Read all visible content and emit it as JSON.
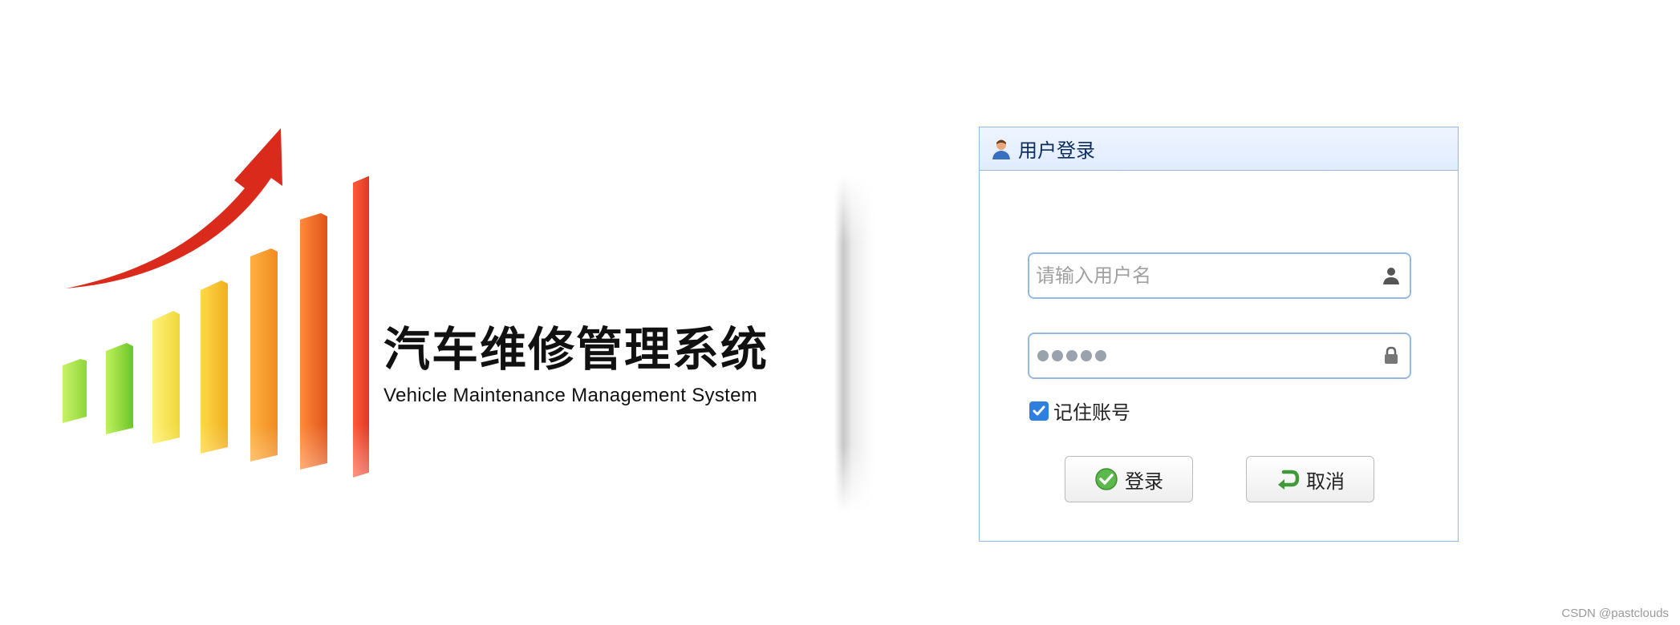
{
  "brand": {
    "title_cn": "汽车维修管理系统",
    "title_en": "Vehicle Maintenance Management System",
    "logo_icon": "growth-bar-chart-icon"
  },
  "login": {
    "header_title": "用户登录",
    "header_icon": "user-icon",
    "username": {
      "placeholder": "请输入用户名",
      "value": "",
      "icon": "user-icon"
    },
    "password": {
      "masked_value": "•••••",
      "icon": "lock-icon"
    },
    "remember": {
      "label": "记住账号",
      "checked": true
    },
    "buttons": {
      "login": {
        "label": "登录",
        "icon": "check-circle-icon"
      },
      "cancel": {
        "label": "取消",
        "icon": "undo-arrow-icon"
      }
    },
    "colors": {
      "panel_border": "#95b8e7",
      "header_bg": "#e0ecff",
      "checkbox": "#2f7fe0"
    }
  },
  "watermark": "CSDN @pastclouds"
}
